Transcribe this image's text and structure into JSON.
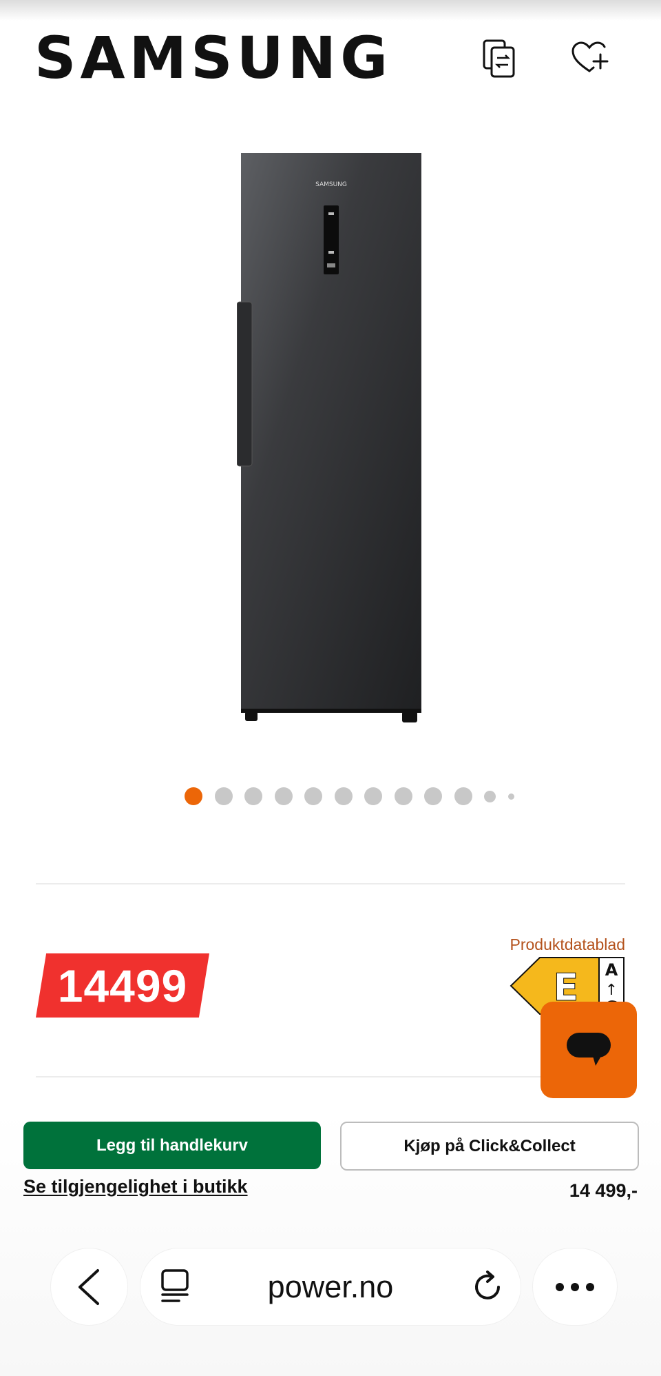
{
  "header": {
    "brand": "SAMSUNG",
    "compare_icon": "compare-icon",
    "wishlist_icon": "heart-plus-icon"
  },
  "gallery": {
    "image_alt": "SAMSUNG",
    "dots_total": 12,
    "active_index": 0
  },
  "price": {
    "badge": "14499",
    "datablad_label": "Produktdatablad",
    "energy_class": "E",
    "energy_scale_top": "A",
    "energy_scale_arrow": "↑",
    "energy_scale_bottom": "G"
  },
  "actions": {
    "add_to_cart": "Legg til handlekurv",
    "click_collect": "Kjøp på Click&Collect",
    "store_availability": "Se tilgjengelighet i butikk",
    "price_formatted": "14 499,-"
  },
  "browser": {
    "url": "power.no"
  },
  "colors": {
    "accent_orange": "#ec6608",
    "price_red": "#f0312e",
    "cart_green": "#00723b",
    "energy_yellow": "#f5b81c"
  }
}
